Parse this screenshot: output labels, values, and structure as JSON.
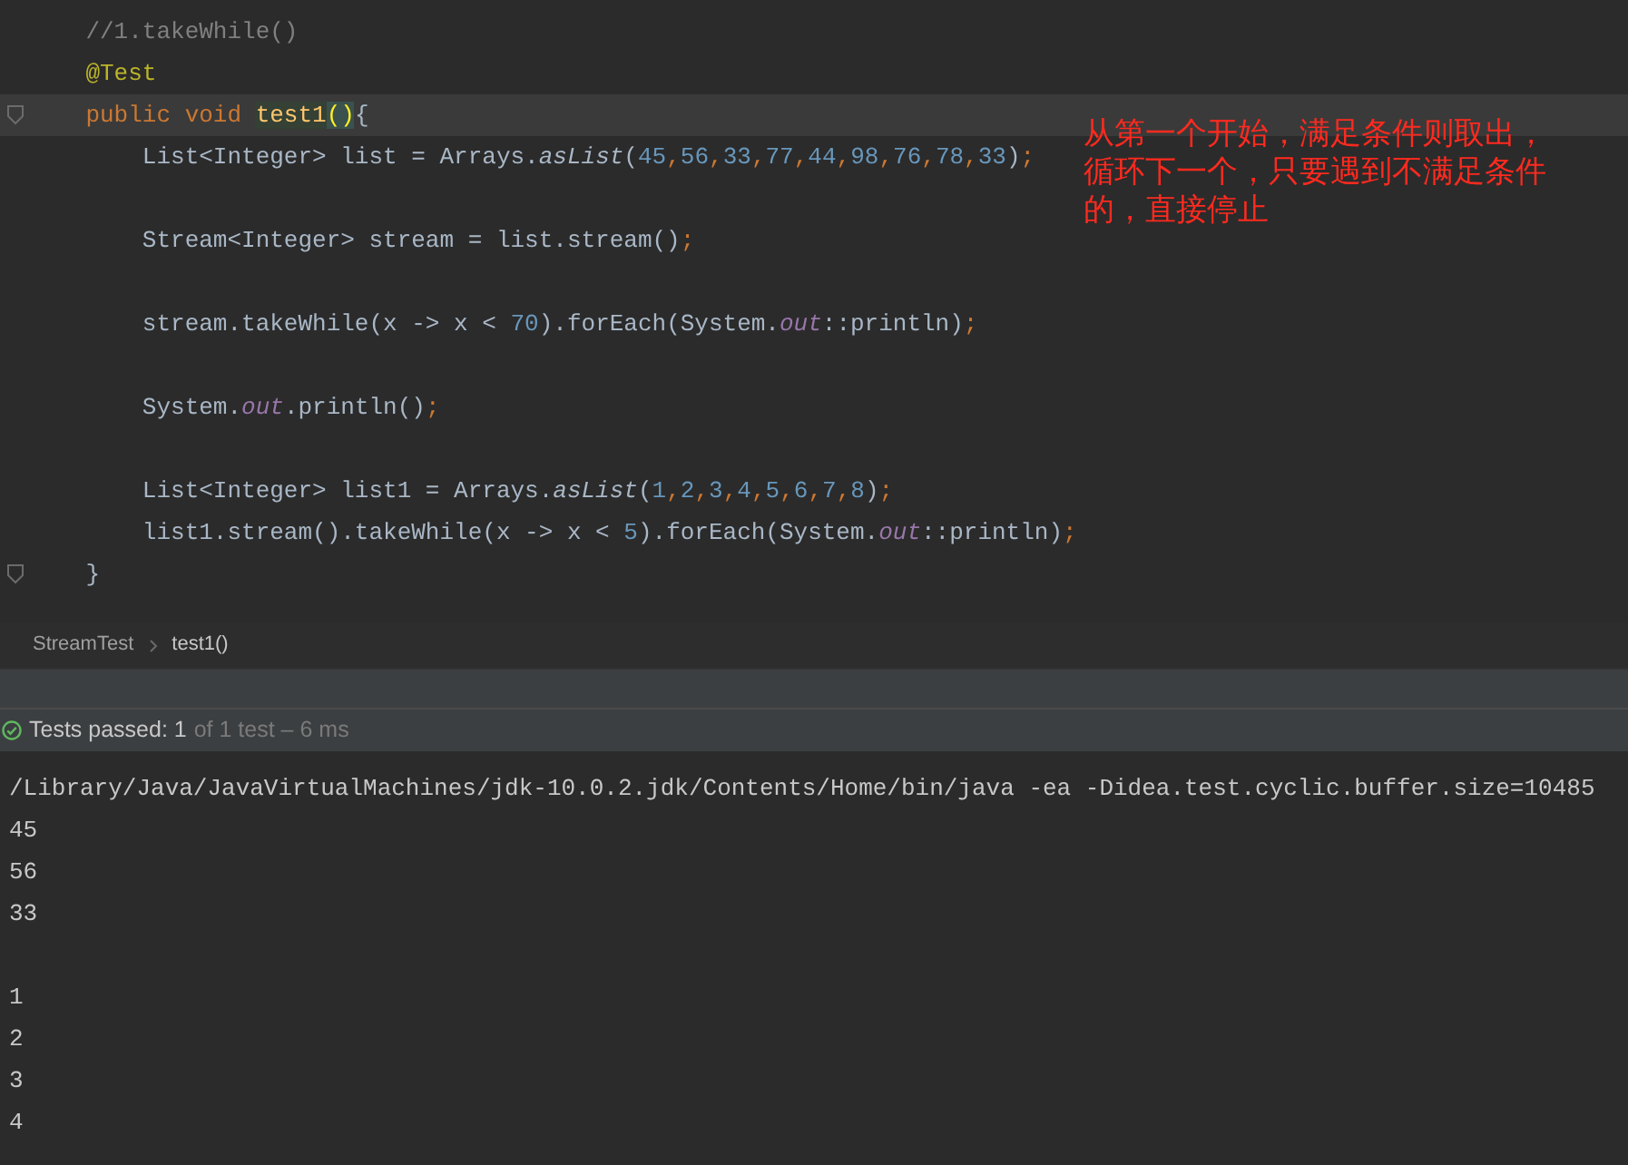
{
  "editor": {
    "lines": [
      {
        "kind": "code",
        "current": false,
        "tokens": [
          {
            "text": "    //1.takeWhile()",
            "kind": "comment"
          }
        ]
      },
      {
        "kind": "code",
        "current": false,
        "tokens": [
          {
            "text": "    @Test",
            "kind": "annotation"
          }
        ]
      },
      {
        "kind": "code",
        "current": true,
        "fold": true,
        "tokens": [
          {
            "text": "    public void ",
            "kind": "keyword"
          },
          {
            "text": "test1",
            "kind": "method_decl"
          },
          {
            "text": "()",
            "kind": "matched_paren"
          },
          {
            "text": "{",
            "kind": "plain"
          }
        ]
      },
      {
        "kind": "code",
        "current": false,
        "tokens": [
          {
            "text": "        List<Integer> list = Arrays.",
            "kind": "plain"
          },
          {
            "text": "asList",
            "kind": "static"
          },
          {
            "text": "(",
            "kind": "plain"
          },
          {
            "text": "45",
            "kind": "number"
          },
          {
            "text": ",",
            "kind": "punct"
          },
          {
            "text": "56",
            "kind": "number"
          },
          {
            "text": ",",
            "kind": "punct"
          },
          {
            "text": "33",
            "kind": "number"
          },
          {
            "text": ",",
            "kind": "punct"
          },
          {
            "text": "77",
            "kind": "number"
          },
          {
            "text": ",",
            "kind": "punct"
          },
          {
            "text": "44",
            "kind": "number"
          },
          {
            "text": ",",
            "kind": "punct"
          },
          {
            "text": "98",
            "kind": "number"
          },
          {
            "text": ",",
            "kind": "punct"
          },
          {
            "text": "76",
            "kind": "number"
          },
          {
            "text": ",",
            "kind": "punct"
          },
          {
            "text": "78",
            "kind": "number"
          },
          {
            "text": ",",
            "kind": "punct"
          },
          {
            "text": "33",
            "kind": "number"
          },
          {
            "text": ")",
            "kind": "plain"
          },
          {
            "text": ";",
            "kind": "punct"
          }
        ]
      },
      {
        "kind": "blank"
      },
      {
        "kind": "code",
        "current": false,
        "tokens": [
          {
            "text": "        Stream<Integer> stream = list.stream()",
            "kind": "plain"
          },
          {
            "text": ";",
            "kind": "punct"
          }
        ]
      },
      {
        "kind": "blank"
      },
      {
        "kind": "code",
        "current": false,
        "tokens": [
          {
            "text": "        stream.takeWhile(x -> x < ",
            "kind": "plain"
          },
          {
            "text": "70",
            "kind": "number"
          },
          {
            "text": ").forEach(System.",
            "kind": "plain"
          },
          {
            "text": "out",
            "kind": "field"
          },
          {
            "text": "::println)",
            "kind": "plain"
          },
          {
            "text": ";",
            "kind": "punct"
          }
        ]
      },
      {
        "kind": "blank"
      },
      {
        "kind": "code",
        "current": false,
        "tokens": [
          {
            "text": "        System.",
            "kind": "plain"
          },
          {
            "text": "out",
            "kind": "field"
          },
          {
            "text": ".println()",
            "kind": "plain"
          },
          {
            "text": ";",
            "kind": "punct"
          }
        ]
      },
      {
        "kind": "blank"
      },
      {
        "kind": "code",
        "current": false,
        "tokens": [
          {
            "text": "        List<Integer> list1 = Arrays.",
            "kind": "plain"
          },
          {
            "text": "asList",
            "kind": "static"
          },
          {
            "text": "(",
            "kind": "plain"
          },
          {
            "text": "1",
            "kind": "number"
          },
          {
            "text": ",",
            "kind": "punct"
          },
          {
            "text": "2",
            "kind": "number"
          },
          {
            "text": ",",
            "kind": "punct"
          },
          {
            "text": "3",
            "kind": "number"
          },
          {
            "text": ",",
            "kind": "punct"
          },
          {
            "text": "4",
            "kind": "number"
          },
          {
            "text": ",",
            "kind": "punct"
          },
          {
            "text": "5",
            "kind": "number"
          },
          {
            "text": ",",
            "kind": "punct"
          },
          {
            "text": "6",
            "kind": "number"
          },
          {
            "text": ",",
            "kind": "punct"
          },
          {
            "text": "7",
            "kind": "number"
          },
          {
            "text": ",",
            "kind": "punct"
          },
          {
            "text": "8",
            "kind": "number"
          },
          {
            "text": ")",
            "kind": "plain"
          },
          {
            "text": ";",
            "kind": "punct"
          }
        ]
      },
      {
        "kind": "code",
        "current": false,
        "tokens": [
          {
            "text": "        list1.stream().takeWhile(x -> x < ",
            "kind": "plain"
          },
          {
            "text": "5",
            "kind": "number"
          },
          {
            "text": ").forEach(System.",
            "kind": "plain"
          },
          {
            "text": "out",
            "kind": "field"
          },
          {
            "text": "::println)",
            "kind": "plain"
          },
          {
            "text": ";",
            "kind": "punct"
          }
        ]
      },
      {
        "kind": "code",
        "current": false,
        "fold": true,
        "tokens": [
          {
            "text": "    }",
            "kind": "plain"
          }
        ]
      }
    ],
    "note": "从第一个开始，满足条件则取出，循环下一个，只要遇到不满足条件的，直接停止"
  },
  "breadcrumb": [
    "StreamTest",
    "test1()"
  ],
  "test_status": {
    "passed": "Tests passed: 1",
    "detail": "of 1 test – 6 ms"
  },
  "console": {
    "command": "/Library/Java/JavaVirtualMachines/jdk-10.0.2.jdk/Contents/Home/bin/java -ea -Didea.test.cyclic.buffer.size=10485",
    "output_groups": [
      [
        "45",
        "56",
        "33"
      ],
      [
        "1",
        "2",
        "3",
        "4"
      ]
    ]
  }
}
